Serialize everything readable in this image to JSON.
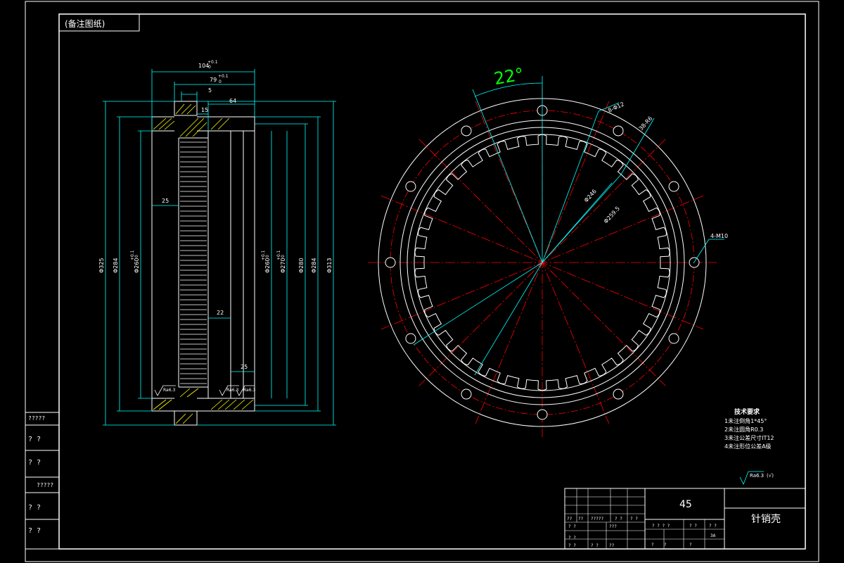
{
  "frame": {
    "top_label": "(备注图纸)",
    "side_labels": [
      "?????",
      "?  ?",
      "?  ?",
      "?????",
      "?  ?",
      "?  ?"
    ]
  },
  "section_view": {
    "dims_top": [
      "104",
      "+0.1",
      "0",
      "79",
      "+0.1",
      "0",
      "5",
      "64",
      "15"
    ],
    "dims_left": [
      "Φ325",
      "Φ284",
      "Φ260",
      "+0.1",
      "0"
    ],
    "dims_right": [
      "Φ260",
      "+0.1",
      "0",
      "Φ270",
      "+0.1",
      "0",
      "Φ280",
      "Φ284",
      "Φ313"
    ],
    "dims_inner": [
      "25",
      "22",
      "25"
    ],
    "roughness": [
      "Ra6.3",
      "Ra6.3",
      "Ra6.3"
    ]
  },
  "front_view": {
    "angle_label": "22°",
    "callouts": [
      "8-Φ12",
      "38-R6",
      "Φ246",
      "Φ259.5",
      "4-M10"
    ]
  },
  "technical": {
    "heading": "技术要求",
    "items": [
      "1未注倒角1*45°",
      "2未注圆角R0.3",
      "3未注公差尺寸IT12",
      "4未注形位公差A级"
    ]
  },
  "roughness_note": {
    "value": "Ra6.3",
    "extra": "(√)"
  },
  "title_block": {
    "material": "45",
    "part_name": "针销壳",
    "cells": [
      "??",
      "??",
      "?????",
      "? ?",
      "? ?",
      "? ?",
      "???",
      "? ?",
      "? ? ? ?",
      "? ?",
      "? ?",
      "? ?",
      "? ?",
      "??",
      "?",
      "?",
      "?",
      "3A"
    ]
  },
  "colors": {
    "outline": "#ffffff",
    "dimension": "#00ffff",
    "centerline": "#ff0000",
    "angle": "#00ff00",
    "hatch": "#ffff00"
  }
}
